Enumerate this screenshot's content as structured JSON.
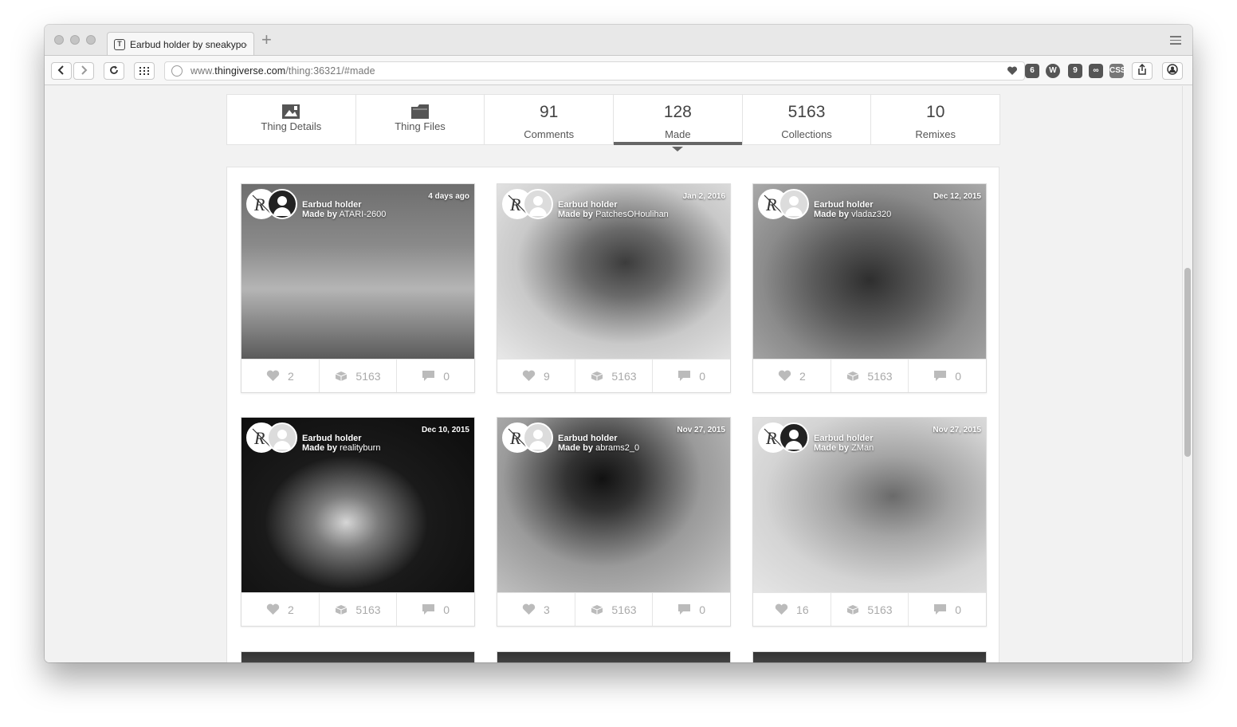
{
  "browser": {
    "tab_title": "Earbud holder by sneakypoo",
    "url_prefix": "www.",
    "url_host": "thingiverse.com",
    "url_path": "/thing:36321/#made"
  },
  "nav_tabs": [
    {
      "label": "Thing Details",
      "icon": "image-icon"
    },
    {
      "label": "Thing Files",
      "icon": "folder-icon"
    },
    {
      "count": "91",
      "label": "Comments"
    },
    {
      "count": "128",
      "label": "Made",
      "active": true
    },
    {
      "count": "5163",
      "label": "Collections"
    },
    {
      "count": "10",
      "label": "Remixes"
    }
  ],
  "cards": [
    {
      "title": "Earbud holder",
      "made_by": "Made by",
      "user": "ATARI-2600",
      "date": "4 days ago",
      "likes": "2",
      "collections": "5163",
      "comments": "0"
    },
    {
      "title": "Earbud holder",
      "made_by": "Made by",
      "user": "PatchesOHoulihan",
      "date": "Jan 2, 2016",
      "likes": "9",
      "collections": "5163",
      "comments": "0"
    },
    {
      "title": "Earbud holder",
      "made_by": "Made by",
      "user": "vladaz320",
      "date": "Dec 12, 2015",
      "likes": "2",
      "collections": "5163",
      "comments": "0"
    },
    {
      "title": "Earbud holder",
      "made_by": "Made by",
      "user": "realityburn",
      "date": "Dec 10, 2015",
      "likes": "2",
      "collections": "5163",
      "comments": "0"
    },
    {
      "title": "Earbud holder",
      "made_by": "Made by",
      "user": "abrams2_0",
      "date": "Nov 27, 2015",
      "likes": "3",
      "collections": "5163",
      "comments": "0"
    },
    {
      "title": "Earbud holder",
      "made_by": "Made by",
      "user": "ZMan",
      "date": "Nov 27, 2015",
      "likes": "16",
      "collections": "5163",
      "comments": "0"
    }
  ]
}
